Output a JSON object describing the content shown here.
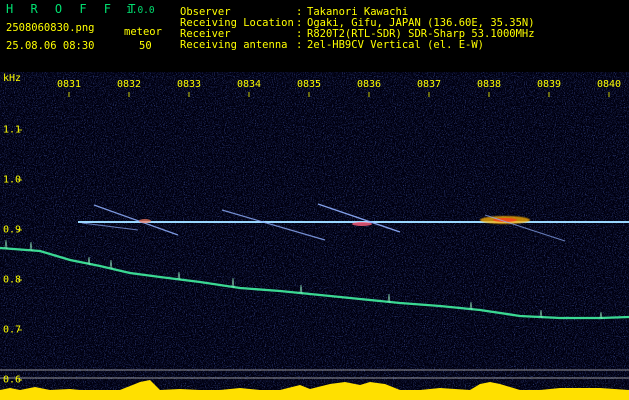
{
  "app": {
    "name": "H R O F F T",
    "version": "1.0.0"
  },
  "file": {
    "name": "2508060830.png",
    "datetime": "25.08.06 08:30"
  },
  "meteor": {
    "label": "meteor",
    "count": "50"
  },
  "info": [
    {
      "key": "Observer",
      "value": "Takanori Kawachi"
    },
    {
      "key": "Receiving Location",
      "value": "Ogaki, Gifu, JAPAN (136.60E, 35.35N)"
    },
    {
      "key": "Receiver",
      "value": "R820T2(RTL-SDR) SDR-Sharp 53.1000MHz"
    },
    {
      "key": "Receiving antenna",
      "value": "2el-HB9CV Vertical (el. E-W)"
    }
  ],
  "axis": {
    "unit": "kHz",
    "x_ticks": [
      "0831",
      "0832",
      "0833",
      "0834",
      "0835",
      "0836",
      "0837",
      "0838",
      "0839",
      "0840"
    ],
    "y_ticks": [
      "1.1",
      "1.0",
      "0.9",
      "0.8",
      "0.7",
      "0.6"
    ]
  },
  "colors": {
    "label": "#ffff00",
    "title": "#00e070",
    "background": "#000010",
    "carrier": "#70c8ff",
    "noise_band": "#40f0a0"
  }
}
